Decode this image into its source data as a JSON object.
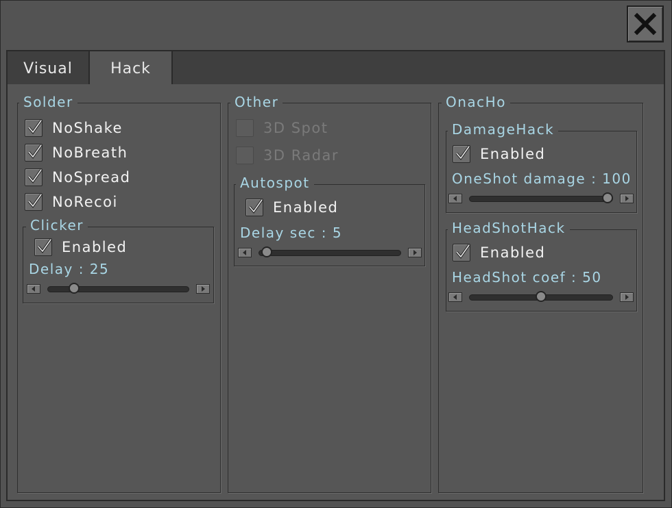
{
  "tabs": [
    {
      "label": "Visual",
      "active": false
    },
    {
      "label": "Hack",
      "active": true
    }
  ],
  "close_icon": "close-icon",
  "solder": {
    "title": "Solder",
    "checks": [
      {
        "label": "NoShake",
        "checked": true
      },
      {
        "label": "NoBreath",
        "checked": true
      },
      {
        "label": "NoSpread",
        "checked": true
      },
      {
        "label": "NoRecoi",
        "checked": true
      }
    ],
    "clicker": {
      "title": "Clicker",
      "enabled_label": "Enabled",
      "enabled": true,
      "delay_label": "Delay : 25",
      "delay_value": 25,
      "slider_fraction": 0.16
    }
  },
  "other": {
    "title": "Other",
    "checks": [
      {
        "label": "3D Spot",
        "checked": false,
        "disabled": true
      },
      {
        "label": "3D Radar",
        "checked": false,
        "disabled": true
      }
    ],
    "autospot": {
      "title": "Autospot",
      "enabled_label": "Enabled",
      "enabled": true,
      "delay_label": "Delay sec : 5",
      "delay_value": 5,
      "slider_fraction": 0.02
    }
  },
  "onacho": {
    "title": "OnacHo",
    "damagehack": {
      "title": "DamageHack",
      "enabled_label": "Enabled",
      "enabled": true,
      "value_label": "OneShot damage : 100",
      "value": 100,
      "slider_fraction": 1.0
    },
    "headshothack": {
      "title": "HeadShotHack",
      "enabled_label": "Enabled",
      "enabled": true,
      "value_label": "HeadShot coef : 50",
      "value": 50,
      "slider_fraction": 0.5
    }
  },
  "colors": {
    "accent_text": "#a9d6e5",
    "panel_bg": "#565656",
    "tabbar_bg": "#3f3f3f"
  }
}
